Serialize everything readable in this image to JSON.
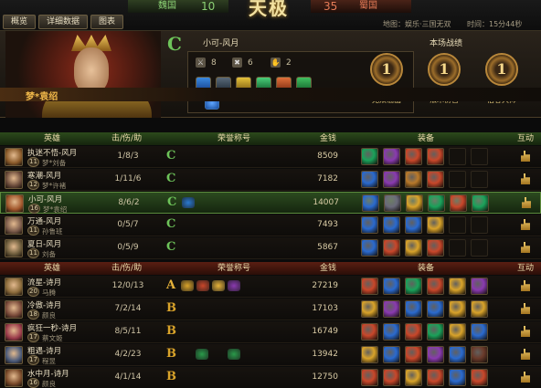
{
  "tabs": [
    "概览",
    "详细数据",
    "图表"
  ],
  "score": {
    "wei_name": "魏国",
    "wei_score": "10",
    "shu_score": "35",
    "shu_name": "蜀国",
    "logo": "天极"
  },
  "map_info": "地图：娱乐·三国无双",
  "time_info": "时间：15分44秒",
  "hero_panel": {
    "hero_banner": "梦*袁绍",
    "player_title": "小可-风月",
    "kills": "8",
    "deaths": "6",
    "assists": "2",
    "record_title": "本场战绩",
    "medals": [
      {
        "rank": "1",
        "label": "无双输出",
        "color": "#d88a2a"
      },
      {
        "rank": "1",
        "label": "法术伤害",
        "color": "#d88a2a"
      },
      {
        "rank": "1",
        "label": "佰客大师",
        "color": "#d88a2a"
      }
    ]
  },
  "headers": {
    "hero": "英雄",
    "kda": "击/伤/助",
    "honor": "荣誉称号",
    "gold": "金钱",
    "equip": "装备",
    "interact": "互动"
  },
  "wei_players": [
    {
      "name": "执迷不悟-风月",
      "level": "11",
      "hero": "梦*刘备",
      "kda": "1/8/3",
      "rank": "C",
      "rank_color": "#6ec45a",
      "honors": [],
      "gold": "8509",
      "avatar": "#8a5a2a",
      "items": [
        "#1aa25a",
        "#8a3ab0",
        "#c9472a",
        "#c9472a",
        "",
        ""
      ]
    },
    {
      "name": "寒潮-风月",
      "level": "12",
      "hero": "梦*许褚",
      "kda": "1/11/6",
      "rank": "C",
      "rank_color": "#6ec45a",
      "honors": [],
      "gold": "7182",
      "avatar": "#6a4a3a",
      "items": [
        "#2a6acf",
        "#8a3ab0",
        "#b9792a",
        "#c9472a",
        "",
        ""
      ]
    },
    {
      "name": "小可-风月",
      "level": "16",
      "hero": "梦*袁绍",
      "kda": "8/6/2",
      "rank": "C",
      "rank_color": "#6ec45a",
      "honors": [
        "#2a7ad0"
      ],
      "gold": "14007",
      "avatar": "#a0552a",
      "items": [
        "#2a6acf",
        "#6a6a7a",
        "#d9a32a",
        "#1aa25a",
        "#c9472a",
        "#1aa25a"
      ]
    },
    {
      "name": "万通-风月",
      "level": "11",
      "hero": "孙鲁班",
      "kda": "0/5/7",
      "rank": "C",
      "rank_color": "#6ec45a",
      "honors": [],
      "gold": "7493",
      "avatar": "#7a5a4a",
      "items": [
        "#2a6acf",
        "#2a6acf",
        "#2a6acf",
        "#d9a32a",
        "",
        ""
      ]
    },
    {
      "name": "夏日-风月",
      "level": "11",
      "hero": "刘备",
      "kda": "0/5/9",
      "rank": "C",
      "rank_color": "#6ec45a",
      "honors": [],
      "gold": "5867",
      "avatar": "#6a5a3a",
      "items": [
        "#2a6acf",
        "#c9472a",
        "#d9a32a",
        "#c9472a",
        "",
        ""
      ]
    }
  ],
  "shu_players": [
    {
      "name": "流星-诗月",
      "level": "20",
      "hero": "马腾",
      "kda": "12/0/13",
      "rank": "A",
      "rank_color": "#e6b23a",
      "honors": [
        "#d9a32a",
        "#c9472a",
        "#e6b23a",
        "#8a3ab0"
      ],
      "gold": "27219",
      "avatar": "#8a6a3a",
      "items": [
        "#c9472a",
        "#2a6acf",
        "#1aa25a",
        "#c9472a",
        "#d9a32a",
        "#8a3ab0"
      ]
    },
    {
      "name": "冷傲-诗月",
      "level": "18",
      "hero": "颜良",
      "kda": "7/2/14",
      "rank": "B",
      "rank_color": "#d9a32a",
      "honors": [],
      "gold": "17103",
      "avatar": "#7a4a3a",
      "items": [
        "#d9a32a",
        "#8a3ab0",
        "#2a6acf",
        "#2a6acf",
        "#d9a32a",
        "#d9a32a"
      ]
    },
    {
      "name": "疯狂一秒-诗月",
      "level": "17",
      "hero": "蔡文姬",
      "kda": "8/5/11",
      "rank": "B",
      "rank_color": "#d9a32a",
      "honors": [],
      "gold": "16749",
      "avatar": "#9a3a4a",
      "items": [
        "#c9472a",
        "#2a6acf",
        "#c9472a",
        "#1aa25a",
        "#d9a32a",
        "#2a6acf"
      ]
    },
    {
      "name": "粗遇-诗月",
      "level": "17",
      "hero": "程昱",
      "kda": "4/2/23",
      "rank": "B",
      "rank_color": "#d9a32a",
      "honors": [
        "#2a9a4a",
        "#2a9a4a"
      ],
      "gold": "13942",
      "avatar": "#4a5a7a",
      "items": [
        "#d9a32a",
        "#2a6acf",
        "#c9472a",
        "#8a3ab0",
        "#2a6acf",
        "#6a3a2a"
      ]
    },
    {
      "name": "水中月-诗月",
      "level": "16",
      "hero": "颜良",
      "kda": "4/1/14",
      "rank": "B",
      "rank_color": "#d9a32a",
      "honors": [],
      "gold": "12750",
      "avatar": "#7a4a2a",
      "items": [
        "#c9472a",
        "#c9472a",
        "#d9a32a",
        "#c9472a",
        "#2a6acf",
        "#c9472a"
      ]
    }
  ],
  "colors": {
    "accent_gold": "#f0b84a",
    "wei_green": "#8bd074",
    "shu_red": "#e57b57"
  }
}
